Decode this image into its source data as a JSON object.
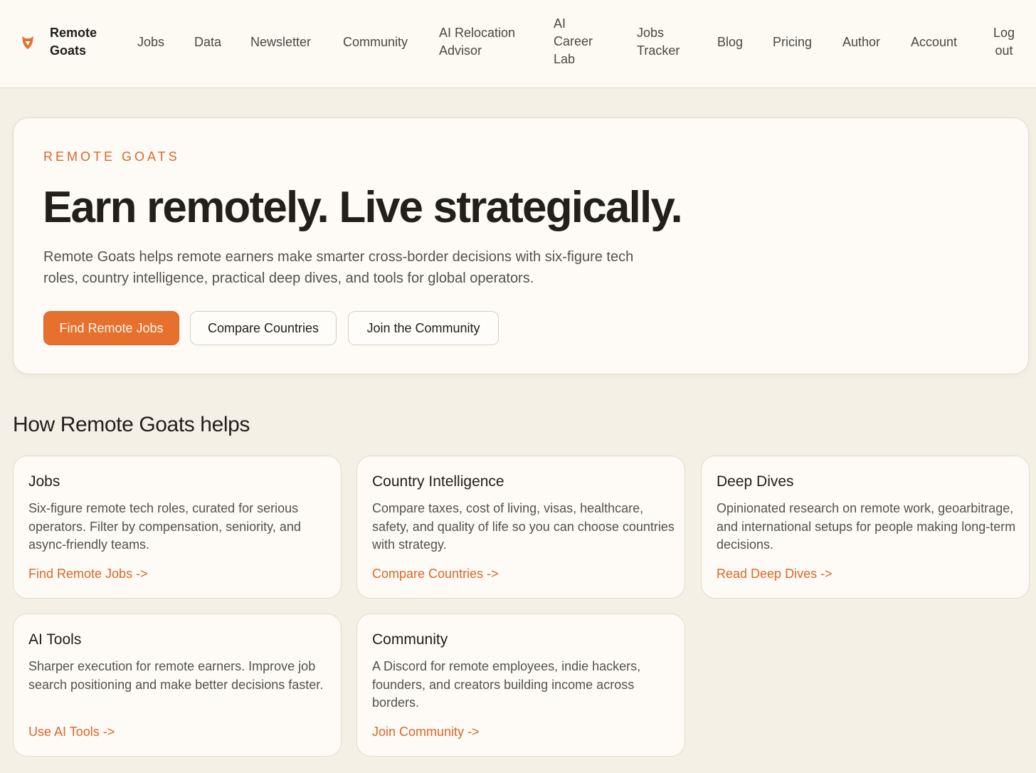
{
  "nav": {
    "brand": "Remote Goats",
    "links": [
      "Jobs",
      "Data",
      "Newsletter",
      "Community",
      "AI Relocation Advisor",
      "AI Career Lab",
      "Jobs Tracker",
      "Blog",
      "Pricing",
      "Author",
      "Account",
      "Log out"
    ]
  },
  "hero": {
    "eyebrow": "REMOTE GOATS",
    "title": "Earn remotely. Live strategically.",
    "description": "Remote Goats helps remote earners make smarter cross-border decisions with six-figure tech roles, country intelligence, practical deep dives, and tools for global operators.",
    "buttons": {
      "find_jobs": "Find Remote Jobs",
      "compare": "Compare Countries",
      "community": "Join the Community"
    }
  },
  "section": {
    "title": "How Remote Goats helps",
    "cards": [
      {
        "title": "Jobs",
        "description": "Six-figure remote tech roles, curated for serious operators. Filter by compensation, seniority, and async-friendly teams.",
        "link": "Find Remote Jobs ->"
      },
      {
        "title": "Country Intelligence",
        "description": "Compare taxes, cost of living, visas, healthcare, safety, and quality of life so you can choose countries with strategy.",
        "link": "Compare Countries ->"
      },
      {
        "title": "Deep Dives",
        "description": "Opinionated research on remote work, geoarbitrage, and international setups for people making long-term decisions.",
        "link": "Read Deep Dives ->"
      },
      {
        "title": "AI Tools",
        "description": "Sharper execution for remote earners. Improve job search positioning and make better decisions faster.",
        "link": "Use AI Tools ->"
      },
      {
        "title": "Community",
        "description": "A Discord for remote employees, indie hackers, founders, and creators building income across borders.",
        "link": "Join Community ->"
      }
    ]
  },
  "colors": {
    "accent": "#e6702e",
    "link": "#d9672a",
    "background": "#f5f0e6",
    "surface": "#fefbf6"
  }
}
